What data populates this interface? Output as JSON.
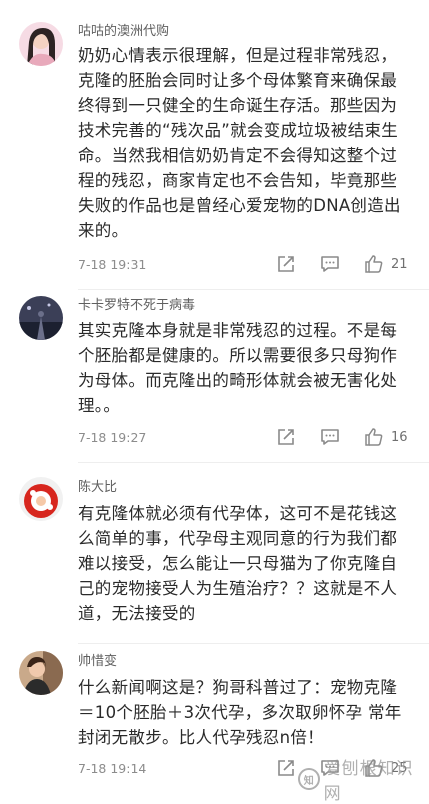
{
  "comments": [
    {
      "username": "咕咕的澳洲代购",
      "content": "奶奶心情表示很理解，但是过程非常残忍，\n克隆的胚胎会同时让多个母体繁育来确保最\n终得到一只健全的生命诞生存活。那些因为\n技术完善的“残次品”就会变成垃圾被结束生\n命。当然我相信奶奶肯定不会得知这整个过\n程的残忍，商家肯定也不会告知，毕竟那些\n失败的作品也是曾经心爱宠物的DNA创造出\n来的。",
      "time": "7-18 19:31",
      "likes": "21"
    },
    {
      "username": "卡卡罗特不死于病毒",
      "content": "其实克隆本身就是非常残忍的过程。不是每\n个胚胎都是健康的。所以需要很多只母狗作\n为母体。而克隆出的畸形体就会被无害化处\n理。。",
      "time": "7-18 19:27",
      "likes": "16"
    },
    {
      "username": "陈大比",
      "content": "有克隆体就必须有代孕体，这可不是花钱这\n么简单的事，代孕母主观同意的行为我们都\n难以接受，怎么能让一只母猫为了你克隆自\n己的宠物接受人为生殖治疗？？这就是不人\n道，无法接受的",
      "time": "",
      "likes": ""
    },
    {
      "username": "帅惜变",
      "content": "什么新闻啊这是？狗哥科普过了：宠物克隆\n＝10个胚胎＋3次代孕，多次取卵怀孕 常年\n封闭无散步。比人代孕残忍n倍！",
      "time": "7-18 19:14",
      "likes": "25"
    }
  ],
  "watermark": {
    "logo": "知",
    "text": "爱刨根知识网"
  },
  "icons": {
    "share": "share-icon",
    "comment": "comment-icon",
    "like": "thumbs-up-icon"
  }
}
